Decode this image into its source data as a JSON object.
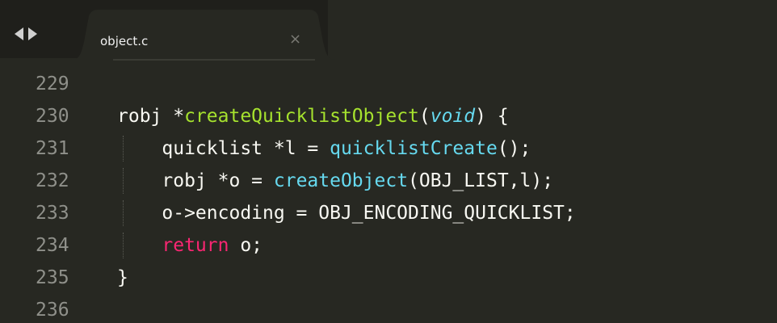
{
  "tab": {
    "filename": "object.c",
    "close_glyph": "×"
  },
  "nav": {
    "back_icon": "triangle-left-icon",
    "forward_icon": "triangle-right-icon"
  },
  "colors": {
    "background": "#272822",
    "gutter_text": "#8f908a",
    "default_text": "#f8f8f2",
    "function_name": "#a6e22e",
    "function_call": "#66d9ef",
    "keyword": "#f92672"
  },
  "editor": {
    "lines": [
      {
        "num": "229",
        "tokens": []
      },
      {
        "num": "230",
        "tokens": [
          {
            "t": "robj *",
            "c": ""
          },
          {
            "t": "createQuicklistObject",
            "c": "tk-fn"
          },
          {
            "t": "(",
            "c": ""
          },
          {
            "t": "void",
            "c": "tk-type"
          },
          {
            "t": ") {",
            "c": ""
          }
        ]
      },
      {
        "num": "231",
        "tokens": [
          {
            "t": "    quicklist *l = ",
            "c": ""
          },
          {
            "t": "quicklistCreate",
            "c": "tk-call"
          },
          {
            "t": "();",
            "c": ""
          }
        ]
      },
      {
        "num": "232",
        "tokens": [
          {
            "t": "    robj *o = ",
            "c": ""
          },
          {
            "t": "createObject",
            "c": "tk-call"
          },
          {
            "t": "(OBJ_LIST,l);",
            "c": ""
          }
        ]
      },
      {
        "num": "233",
        "tokens": [
          {
            "t": "    o->encoding = OBJ_ENCODING_QUICKLIST;",
            "c": ""
          }
        ]
      },
      {
        "num": "234",
        "tokens": [
          {
            "t": "    ",
            "c": ""
          },
          {
            "t": "return",
            "c": "tk-kw"
          },
          {
            "t": " o;",
            "c": ""
          }
        ]
      },
      {
        "num": "235",
        "tokens": [
          {
            "t": "}",
            "c": ""
          }
        ]
      },
      {
        "num": "236",
        "tokens": []
      }
    ]
  }
}
